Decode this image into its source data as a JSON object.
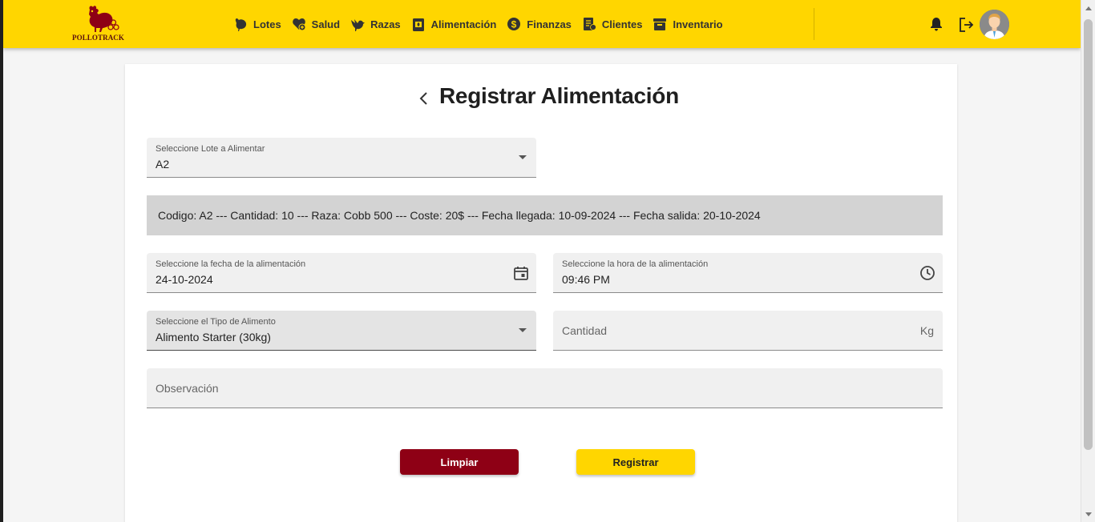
{
  "brand": {
    "name": "POLLOTRACK",
    "color": "#ffd600",
    "accent": "#8e0015"
  },
  "nav": [
    {
      "label": "Lotes",
      "icon": "chicken-icon"
    },
    {
      "label": "Salud",
      "icon": "health-icon"
    },
    {
      "label": "Razas",
      "icon": "bird-icon"
    },
    {
      "label": "Alimentación",
      "icon": "feed-bag-icon"
    },
    {
      "label": "Finanzas",
      "icon": "dollar-icon"
    },
    {
      "label": "Clientes",
      "icon": "clients-icon"
    },
    {
      "label": "Inventario",
      "icon": "archive-icon"
    }
  ],
  "header_actions": {
    "notifications_icon": "bell-icon",
    "logout_icon": "logout-icon",
    "avatar_icon": "user-avatar"
  },
  "page": {
    "title": "Registrar Alimentación"
  },
  "form": {
    "lote": {
      "label": "Seleccione Lote a Alimentar",
      "value": "A2"
    },
    "info": "Codigo: A2 --- Cantidad: 10 --- Raza: Cobb 500 --- Coste: 20$ --- Fecha llegada: 10-09-2024 --- Fecha salida: 20-10-2024",
    "fecha": {
      "label": "Seleccione la fecha de la alimentación",
      "value": "24-10-2024"
    },
    "hora": {
      "label": "Seleccione la hora de la alimentación",
      "value": "09:46 PM"
    },
    "tipo": {
      "label": "Seleccione el Tipo de Alimento",
      "value": "Alimento Starter (30kg)"
    },
    "cantidad": {
      "placeholder": "Cantidad",
      "suffix": "Kg"
    },
    "observacion": {
      "placeholder": "Observación"
    }
  },
  "buttons": {
    "clear": "Limpiar",
    "submit": "Registrar"
  }
}
